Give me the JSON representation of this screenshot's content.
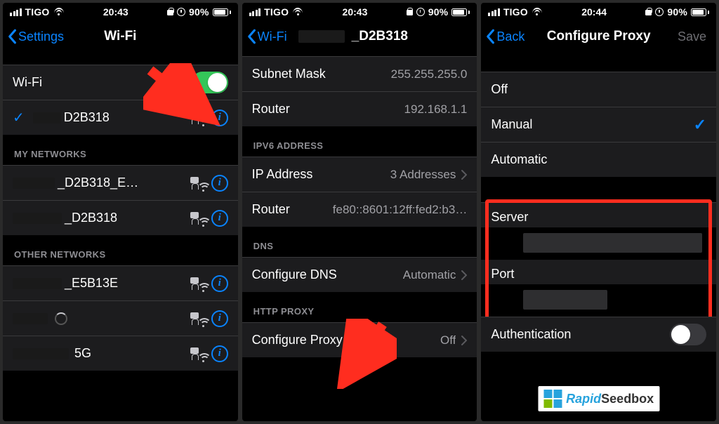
{
  "colors": {
    "blue": "#0a84ff",
    "green": "#34c759",
    "red": "#ff2d1f"
  },
  "status": {
    "carrier": "TIGO",
    "battery_pct": "90%"
  },
  "screens": {
    "s1": {
      "time": "20:43",
      "back": "Settings",
      "title": "Wi-Fi",
      "wifi_toggle": {
        "label": "Wi-Fi",
        "on": true
      },
      "connected_ssid": "D2B318",
      "section_my": "MY NETWORKS",
      "my_networks": [
        "_D2B318_E…",
        "_D2B318"
      ],
      "section_other": "OTHER NETWORKS",
      "other_networks": [
        "_E5B13E",
        "",
        "5G"
      ]
    },
    "s2": {
      "time": "20:43",
      "back": "Wi-Fi",
      "title": "_D2B318",
      "rows": {
        "subnet": {
          "label": "Subnet Mask",
          "value": "255.255.255.0"
        },
        "router": {
          "label": "Router",
          "value": "192.168.1.1"
        }
      },
      "section_ipv6": "IPV6 ADDRESS",
      "ipv6": {
        "ip": {
          "label": "IP Address",
          "value": "3 Addresses"
        },
        "router": {
          "label": "Router",
          "value": "fe80::8601:12ff:fed2:b3…"
        }
      },
      "section_dns": "DNS",
      "dns": {
        "label": "Configure DNS",
        "value": "Automatic"
      },
      "section_proxy": "HTTP PROXY",
      "proxy": {
        "label": "Configure Proxy",
        "value": "Off"
      }
    },
    "s3": {
      "time": "20:44",
      "back": "Back",
      "title": "Configure Proxy",
      "save": "Save",
      "options": {
        "off": "Off",
        "manual": "Manual",
        "auto": "Automatic"
      },
      "selected": "manual",
      "server_label": "Server",
      "port_label": "Port",
      "auth_label": "Authentication",
      "auth_on": false,
      "brand": {
        "a": "Rapid",
        "b": "Seedbox"
      }
    }
  }
}
